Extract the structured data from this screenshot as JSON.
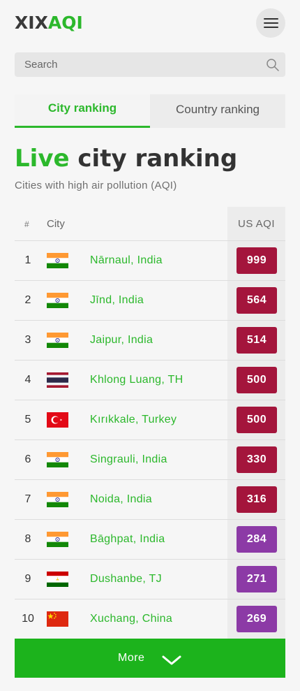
{
  "brand": {
    "logo_part1": "XIX",
    "logo_part2": "AQI"
  },
  "search": {
    "placeholder": "Search"
  },
  "tabs": [
    {
      "label": "City ranking",
      "active": true
    },
    {
      "label": "Country ranking",
      "active": false
    }
  ],
  "page": {
    "title_highlight": "Live",
    "title_rest": "city ranking",
    "subtitle": "Cities with high air pollution (AQI)"
  },
  "table": {
    "headers": {
      "rank": "#",
      "city": "City",
      "aqi": "US AQI"
    },
    "rows": [
      {
        "rank": "1",
        "flag": "india-flag-icon",
        "city": "Nārnaul, India",
        "aqi": "999",
        "color": "#a4153c"
      },
      {
        "rank": "2",
        "flag": "india-flag-icon",
        "city": "Jīnd, India",
        "aqi": "564",
        "color": "#a4153c"
      },
      {
        "rank": "3",
        "flag": "india-flag-icon",
        "city": "Jaipur, India",
        "aqi": "514",
        "color": "#a4153c"
      },
      {
        "rank": "4",
        "flag": "thailand-flag-icon",
        "city": "Khlong Luang, TH",
        "aqi": "500",
        "color": "#a4153c"
      },
      {
        "rank": "5",
        "flag": "turkey-flag-icon",
        "city": "Kırıkkale, Turkey",
        "aqi": "500",
        "color": "#a4153c"
      },
      {
        "rank": "6",
        "flag": "india-flag-icon",
        "city": "Singrauli, India",
        "aqi": "330",
        "color": "#a4153c"
      },
      {
        "rank": "7",
        "flag": "india-flag-icon",
        "city": "Noida, India",
        "aqi": "316",
        "color": "#a4153c"
      },
      {
        "rank": "8",
        "flag": "india-flag-icon",
        "city": "Bāghpat, India",
        "aqi": "284",
        "color": "#8c3aa6"
      },
      {
        "rank": "9",
        "flag": "tajikistan-flag-icon",
        "city": "Dushanbe, TJ",
        "aqi": "271",
        "color": "#8c3aa6"
      },
      {
        "rank": "10",
        "flag": "china-flag-icon",
        "city": "Xuchang, China",
        "aqi": "269",
        "color": "#8c3aa6"
      }
    ]
  },
  "more_button": {
    "label": "More"
  },
  "colors": {
    "brand_green": "#2cb82c",
    "hazardous": "#a4153c",
    "very_unhealthy": "#8c3aa6"
  }
}
